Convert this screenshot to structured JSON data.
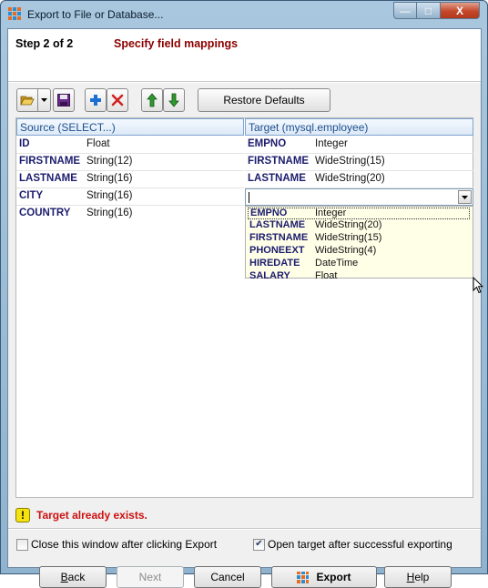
{
  "window": {
    "title": "Export to File or Database...",
    "controls": {
      "minimize": "—",
      "maximize": "□",
      "close": "X"
    }
  },
  "header": {
    "step": "Step 2 of 2",
    "subtitle": "Specify field mappings"
  },
  "toolbar": {
    "buttons": [
      "open-folder-icon",
      "dropdown-arrow-icon",
      "save-icon",
      "add-icon",
      "delete-icon",
      "move-up-icon",
      "move-down-icon"
    ],
    "restore_label": "Restore Defaults"
  },
  "grid": {
    "source_header": "Source (SELECT...)",
    "target_header": "Target (mysql.employee)",
    "source_rows": [
      {
        "name": "ID",
        "type": "Float"
      },
      {
        "name": "FIRSTNAME",
        "type": "String(12)"
      },
      {
        "name": "LASTNAME",
        "type": "String(16)"
      },
      {
        "name": "CITY",
        "type": "String(16)"
      },
      {
        "name": "COUNTRY",
        "type": "String(16)"
      }
    ],
    "target_rows": [
      {
        "name": "EMPNO",
        "type": "Integer"
      },
      {
        "name": "FIRSTNAME",
        "type": "WideString(15)"
      },
      {
        "name": "LASTNAME",
        "type": "WideString(20)"
      }
    ],
    "target_edit_value": ""
  },
  "dropdown": {
    "options": [
      {
        "name": "EMPNO",
        "type": "Integer"
      },
      {
        "name": "LASTNAME",
        "type": "WideString(20)"
      },
      {
        "name": "FIRSTNAME",
        "type": "WideString(15)"
      },
      {
        "name": "PHONEEXT",
        "type": "WideString(4)"
      },
      {
        "name": "HIREDATE",
        "type": "DateTime"
      },
      {
        "name": "SALARY",
        "type": "Float"
      }
    ]
  },
  "warning": {
    "icon": "!",
    "text": "Target already exists."
  },
  "options": {
    "close_window": {
      "label": "Close this window after clicking Export",
      "checked": false
    },
    "open_target": {
      "label": "Open target after successful exporting",
      "checked": true
    }
  },
  "buttons": {
    "back_accel": "B",
    "back_rest": "ack",
    "next": "Next",
    "cancel": "Cancel",
    "export": "Export",
    "help_accel": "H",
    "help_rest": "elp"
  },
  "colors": {
    "subtitle": "#8b0000",
    "warning_text": "#cc1010",
    "field_name": "#1c1c6e",
    "dropdown_bg": "#ffffe8"
  }
}
